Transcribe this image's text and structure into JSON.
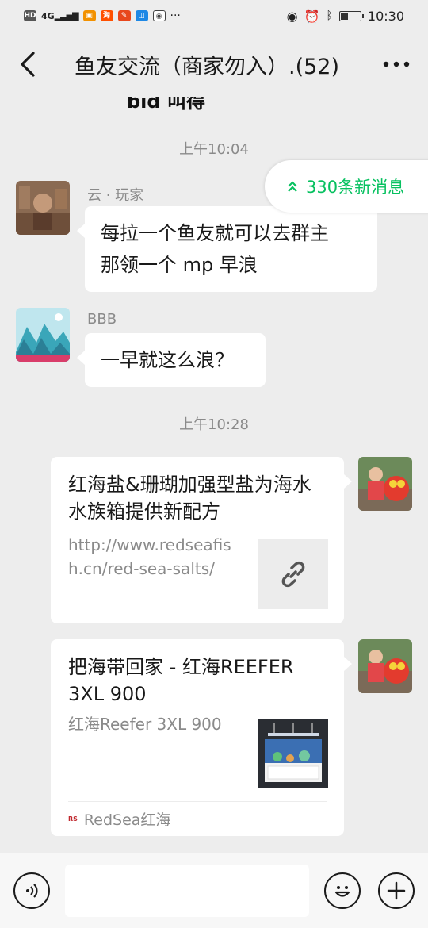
{
  "status_bar": {
    "left_labels": [
      "HD",
      "4G",
      "淘",
      "№",
      "№"
    ],
    "time": "10:30",
    "battery_level": 0.35
  },
  "header": {
    "title": "鱼友交流（商家勿入）.(52)"
  },
  "chat": {
    "cutoff_text": "bid 叫得",
    "new_messages": "330条新消息",
    "timestamps": [
      "上午10:04",
      "上午10:28"
    ],
    "messages": [
      {
        "sender": "云 · 玩家",
        "lines": [
          "每拉一个鱼友就可以去群主",
          "那领一个 mp 早浪"
        ]
      },
      {
        "sender": "BBB",
        "lines": [
          "一早就这么浪？"
        ]
      }
    ],
    "cards": [
      {
        "title": "红海盐&珊瑚加强型盐为海水水族箱提供新配方",
        "desc": "http://www.redseafish.cn/red-sea-salts/"
      },
      {
        "title": "把海带回家 - 红海REEFER 3XL 900",
        "desc": "红海Reefer 3XL 900",
        "footer": "RedSea红海"
      }
    ]
  },
  "input_bar": {
    "placeholder": ""
  },
  "colors": {
    "accent": "#07c160",
    "background": "#ededed",
    "bubble": "#ffffff"
  }
}
